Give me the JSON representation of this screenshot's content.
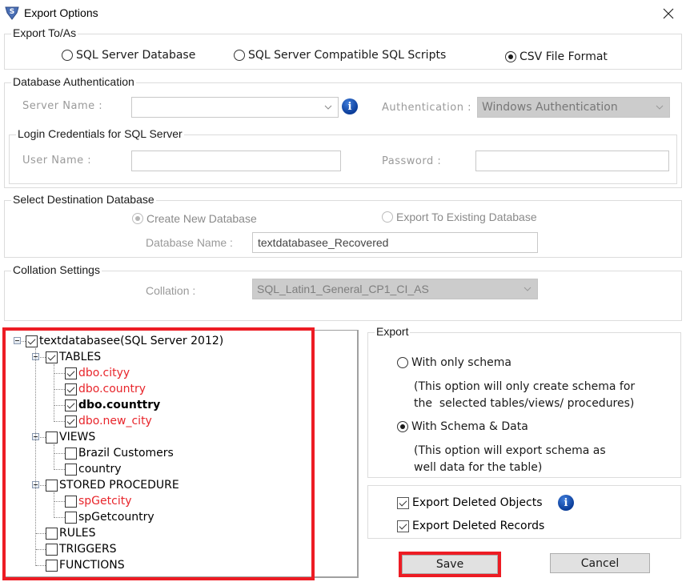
{
  "window": {
    "title": "Export Options",
    "icon": "app-logo-icon",
    "close_icon": "close-icon"
  },
  "export_to": {
    "legend": "Export To/As",
    "options": [
      {
        "label": "SQL Server Database",
        "selected": false
      },
      {
        "label": "SQL Server Compatible SQL Scripts",
        "selected": false
      },
      {
        "label": "CSV File Format",
        "selected": true
      }
    ]
  },
  "db_auth": {
    "legend": "Database Authentication",
    "server_name_label": "Server Name :",
    "server_name_value": "",
    "authentication_label": "Authentication :",
    "authentication_value": "Windows Authentication",
    "login": {
      "legend": "Login Credentials for SQL Server",
      "user_name_label": "User Name :",
      "user_name_value": "",
      "password_label": "Password :",
      "password_value": ""
    }
  },
  "destination": {
    "legend": "Select Destination Database",
    "options": [
      {
        "label": "Create New Database",
        "selected": true
      },
      {
        "label": "Export To Existing Database",
        "selected": false
      }
    ],
    "db_name_label": "Database Name :",
    "db_name_value": "textdatabasee_Recovered"
  },
  "collation": {
    "legend": "Collation Settings",
    "label": "Collation :",
    "value": "SQL_Latin1_General_CP1_CI_AS"
  },
  "tree": {
    "root": {
      "label": "textdatabasee(SQL Server 2012)",
      "checked": true
    },
    "nodes": [
      {
        "label": "TABLES",
        "checked": true,
        "level": 1,
        "expander": true
      },
      {
        "label": "dbo.cityy",
        "checked": true,
        "level": 2,
        "style": "red"
      },
      {
        "label": "dbo.country",
        "checked": true,
        "level": 2,
        "style": "red"
      },
      {
        "label": "dbo.counttry",
        "checked": true,
        "level": 2,
        "style": "bold"
      },
      {
        "label": "dbo.new_city",
        "checked": true,
        "level": 2,
        "style": "red"
      },
      {
        "label": "VIEWS",
        "checked": false,
        "level": 1,
        "expander": true
      },
      {
        "label": "Brazil Customers",
        "checked": false,
        "level": 2,
        "style": ""
      },
      {
        "label": "country",
        "checked": false,
        "level": 2,
        "style": ""
      },
      {
        "label": "STORED PROCEDURE",
        "checked": false,
        "level": 1,
        "expander": true
      },
      {
        "label": "spGetcity",
        "checked": false,
        "level": 2,
        "style": "red"
      },
      {
        "label": "spGetcountry",
        "checked": false,
        "level": 2,
        "style": ""
      },
      {
        "label": "RULES",
        "checked": false,
        "level": 1,
        "expander": false
      },
      {
        "label": "TRIGGERS",
        "checked": false,
        "level": 1,
        "expander": false
      },
      {
        "label": "FUNCTIONS",
        "checked": false,
        "level": 1,
        "expander": false
      }
    ]
  },
  "export": {
    "legend": "Export",
    "options": [
      {
        "label": "With only schema",
        "selected": false,
        "desc_1": "(This option will only create schema for",
        "desc_2": "the  selected tables/views/ procedures)"
      },
      {
        "label": "With Schema & Data",
        "selected": true,
        "desc_1": "(This option will export schema as",
        "desc_2": "well data for the table)"
      }
    ]
  },
  "deleted": {
    "objects_label": "Export Deleted Objects",
    "objects_checked": true,
    "records_label": "Export Deleted Records",
    "records_checked": true
  },
  "buttons": {
    "save": "Save",
    "cancel": "Cancel"
  },
  "colors": {
    "highlight": "#ed1c24",
    "red_item": "#e8252b",
    "info_blue": "#0b3d99"
  }
}
